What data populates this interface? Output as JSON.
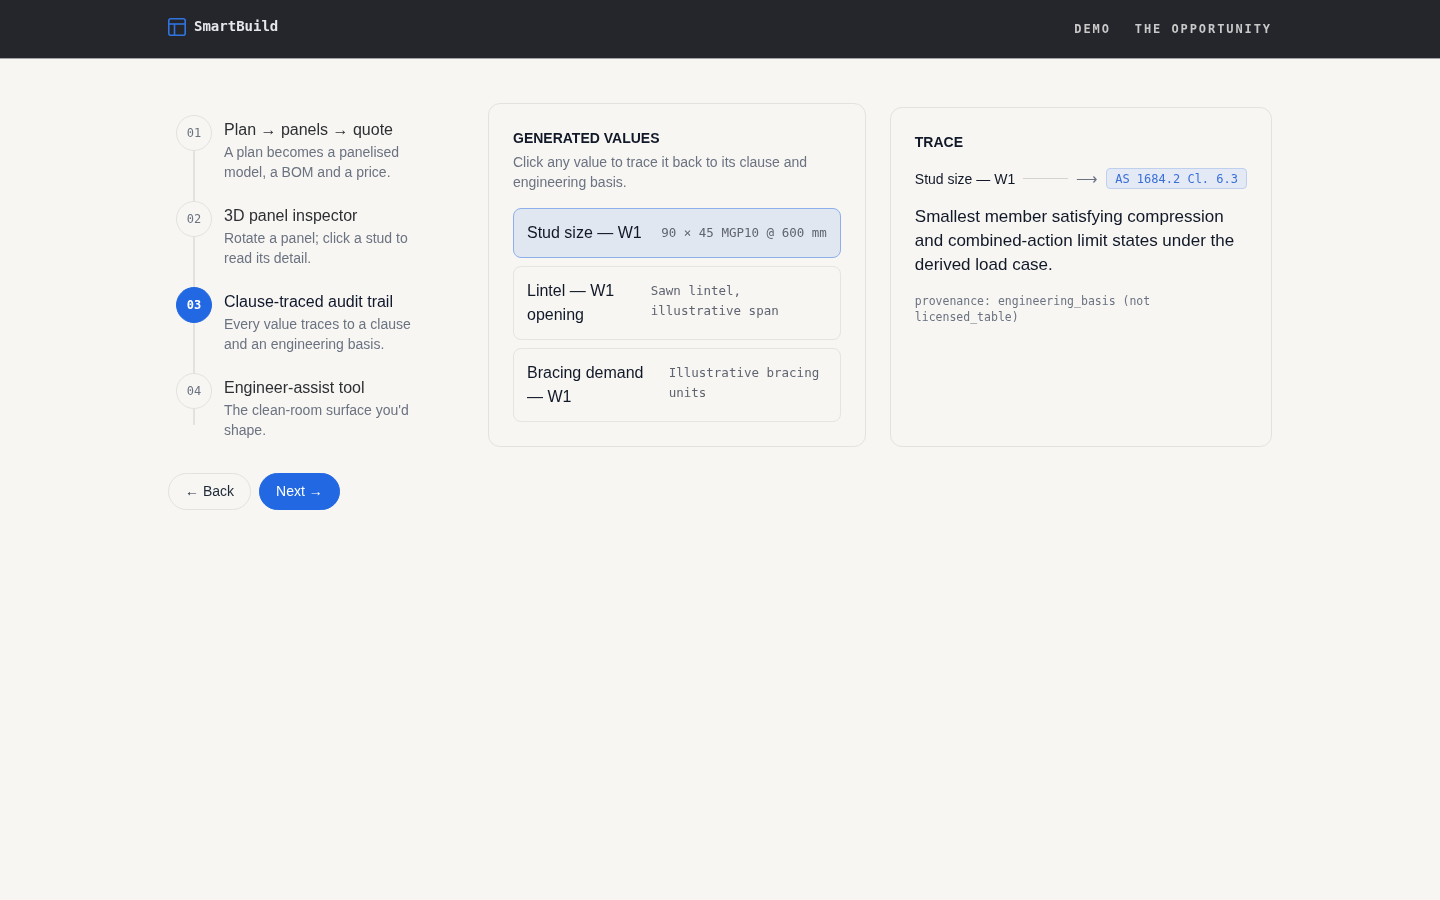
{
  "header": {
    "brand": "SmartBuild",
    "nav": [
      {
        "label": "DEMO"
      },
      {
        "label": "THE OPPORTUNITY"
      }
    ]
  },
  "steps": [
    {
      "number": "01",
      "title": "Plan → panels → quote",
      "description": "A plan becomes a panelised model, a BOM and a price.",
      "selected": false
    },
    {
      "number": "02",
      "title": "3D panel inspector",
      "description": "Rotate a panel; click a stud to read its detail.",
      "selected": false
    },
    {
      "number": "03",
      "title": "Clause-traced audit trail",
      "description": "Every value traces to a clause and an engineering basis.",
      "selected": true
    },
    {
      "number": "04",
      "title": "Engineer-assist tool",
      "description": "The clean-room surface you'd shape.",
      "selected": false
    }
  ],
  "buttons": [
    {
      "label": "← Back",
      "kind": "secondary"
    },
    {
      "label": "Next →",
      "kind": "primary"
    }
  ],
  "generated_values": {
    "title": "GENERATED VALUES",
    "description": "Click any value to trace it back to its clause and engineering basis.",
    "items": [
      {
        "label": "Stud size — W1",
        "value": "90 × 45 MGP10 @ 600 mm",
        "selected": true
      },
      {
        "label": "Lintel — W1 opening",
        "value": "Sawn lintel, illustrative span",
        "selected": false
      },
      {
        "label": "Bracing demand — W1",
        "value": "Illustrative bracing units",
        "selected": false
      }
    ]
  },
  "trace": {
    "title": "TRACE",
    "source": "Stud size — W1",
    "arrow": "⟶",
    "clause": "AS 1684.2 Cl. 6.3",
    "explanation": "Smallest member satisfying compression and combined-action limit states under the derived load case.",
    "provenance": "provenance: engineering_basis (not licensed_table)"
  }
}
